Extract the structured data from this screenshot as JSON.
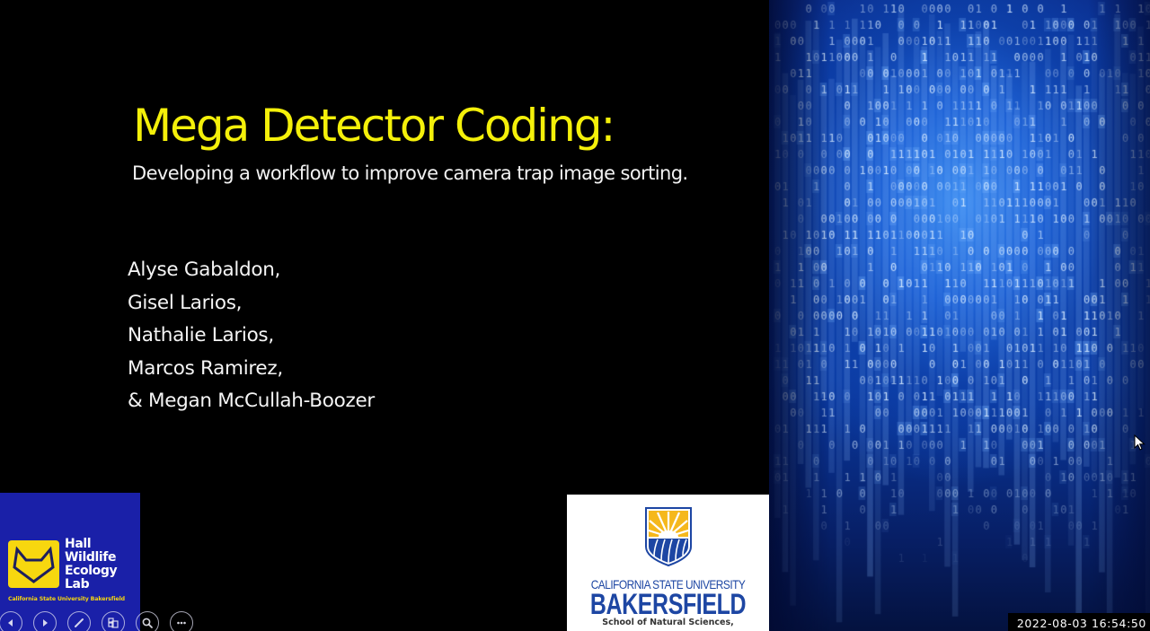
{
  "slide": {
    "title": "Mega Detector Coding:",
    "subtitle": "Developing a workflow to improve camera trap image sorting.",
    "authors": [
      "Alyse Gabaldon,",
      "Gisel Larios,",
      "Nathalie Larios,",
      "Marcos Ramirez,",
      "& Megan McCullah-Boozer"
    ],
    "colors": {
      "title": "#f4f00a",
      "background": "#000000",
      "text": "#f2f2f2"
    }
  },
  "hall_logo": {
    "name_lines": [
      "Hall",
      "Wildlife",
      "Ecology",
      "Lab"
    ],
    "university": "California State University Bakersfield",
    "icon": "fox-head-icon",
    "colors": {
      "background": "#1a20a8",
      "accent": "#f7d70f"
    }
  },
  "csub_logo": {
    "line1": "CALIFORNIA STATE UNIVERSITY",
    "line2": "BAKERSFIELD",
    "line3": "School of Natural Sciences,",
    "icon": "sun-shield-icon",
    "colors": {
      "text": "#1d46a3",
      "gold": "#f5b81c"
    }
  },
  "presenter_toolbar": {
    "buttons": [
      {
        "name": "previous-slide",
        "icon": "chevron-left-icon"
      },
      {
        "name": "next-slide",
        "icon": "chevron-right-icon"
      },
      {
        "name": "pen-tool",
        "icon": "pen-icon"
      },
      {
        "name": "see-all-slides",
        "icon": "slides-icon"
      },
      {
        "name": "zoom-slide",
        "icon": "magnifier-icon"
      },
      {
        "name": "more-options",
        "icon": "ellipsis-icon"
      }
    ]
  },
  "overlay": {
    "timestamp": "2022-08-03  16:54:50"
  }
}
